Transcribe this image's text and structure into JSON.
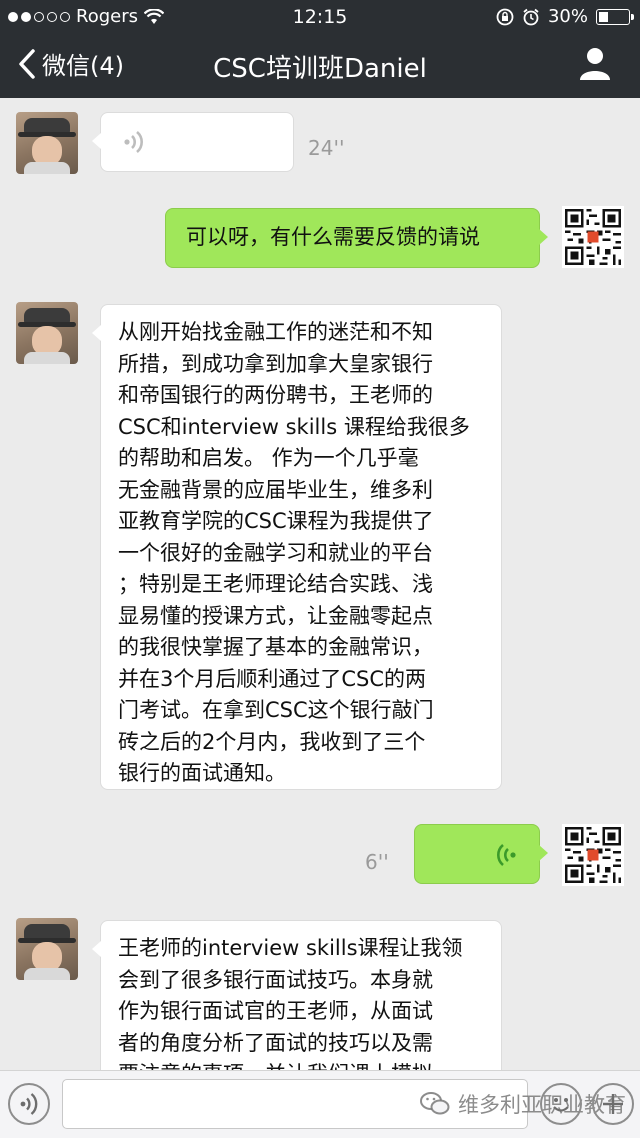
{
  "status_bar": {
    "carrier": "Rogers",
    "time": "12:15",
    "battery": "30%",
    "battery_level": 0.3
  },
  "nav": {
    "back_label": "微信(4)",
    "title": "CSC培训班Daniel"
  },
  "messages": [
    {
      "side": "left",
      "type": "voice",
      "duration": "24''"
    },
    {
      "side": "right",
      "type": "text",
      "text": "可以呀，有什么需要反馈的请说"
    },
    {
      "side": "left",
      "type": "text",
      "text": "从刚开始找金融工作的迷茫和不知\n所措，到成功拿到加拿大皇家银行\n和帝国银行的两份聘书，王老师的\nCSC和interview skills 课程给我很多\n的帮助和启发。 作为一个几乎毫\n无金融背景的应届毕业生，维多利\n亚教育学院的CSC课程为我提供了\n一个很好的金融学习和就业的平台\n；特别是王老师理论结合实践、浅\n显易懂的授课方式，让金融零起点\n的我很快掌握了基本的金融常识，\n并在3个月后顺利通过了CSC的两\n门考试。在拿到CSC这个银行敲门\n砖之后的2个月内，我收到了三个\n银行的面试通知。"
    },
    {
      "side": "right",
      "type": "voice",
      "duration": "6''"
    },
    {
      "side": "left",
      "type": "text",
      "text": "王老师的interview skills课程让我领\n会到了很多银行面试技巧。本身就\n作为银行面试官的王老师，从面试\n者的角度分析了面试的技巧以及需\n要注意的事项，并让我们课上模拟"
    }
  ],
  "input_bar": {
    "watermark": "维多利亚职业教育"
  },
  "colors": {
    "nav_bg": "#2b2f33",
    "chat_bg": "#ebebeb",
    "green_bubble": "#a0e75a",
    "voice_icon_green": "#3b9a2a"
  }
}
